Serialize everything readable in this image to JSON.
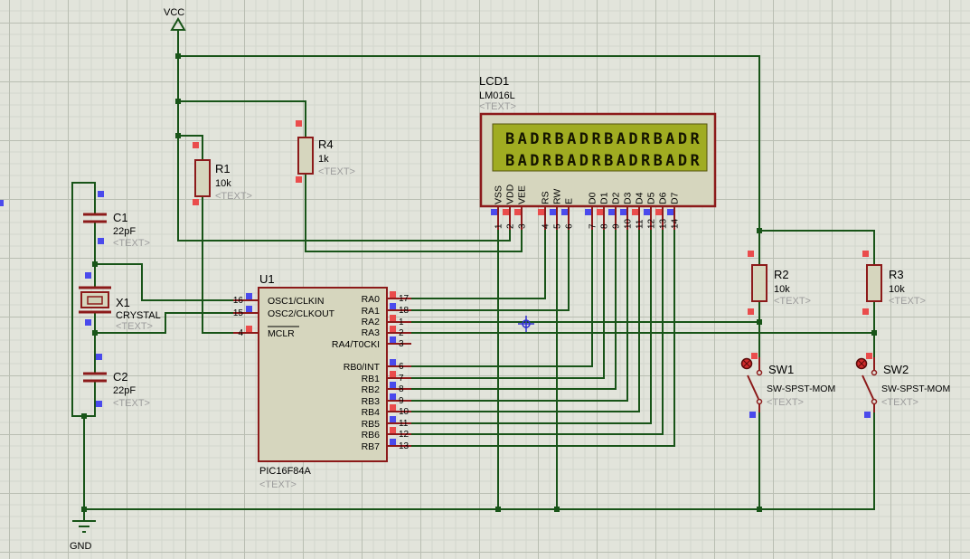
{
  "power": {
    "vcc": "VCC",
    "gnd": "GND"
  },
  "components": {
    "u1": {
      "ref": "U1",
      "value": "PIC16F84A",
      "placeholder": "<TEXT>",
      "left_pins": [
        {
          "num": "16",
          "name": "OSC1/CLKIN",
          "state": "blue"
        },
        {
          "num": "15",
          "name": "OSC2/CLKOUT",
          "state": "blue"
        },
        {
          "num": "4",
          "name": "MCLR",
          "state": "red"
        }
      ],
      "right_pins": [
        {
          "num": "17",
          "name": "RA0",
          "state": "red"
        },
        {
          "num": "18",
          "name": "RA1",
          "state": "blue"
        },
        {
          "num": "1",
          "name": "RA2",
          "state": "red"
        },
        {
          "num": "2",
          "name": "RA3",
          "state": "red"
        },
        {
          "num": "3",
          "name": "RA4/T0CKI",
          "state": "blue"
        },
        {
          "num": "6",
          "name": "RB0/INT",
          "state": "blue"
        },
        {
          "num": "7",
          "name": "RB1",
          "state": "red"
        },
        {
          "num": "8",
          "name": "RB2",
          "state": "blue"
        },
        {
          "num": "9",
          "name": "RB3",
          "state": "blue"
        },
        {
          "num": "10",
          "name": "RB4",
          "state": "red"
        },
        {
          "num": "11",
          "name": "RB5",
          "state": "blue"
        },
        {
          "num": "12",
          "name": "RB6",
          "state": "red"
        },
        {
          "num": "13",
          "name": "RB7",
          "state": "blue"
        }
      ]
    },
    "lcd1": {
      "ref": "LCD1",
      "value": "LM016L",
      "placeholder": "<TEXT>",
      "screen_line1": "BADRBADRBADRBADR",
      "screen_line2": "BADRBADRBADRBADR",
      "pins": [
        {
          "num": "1",
          "name": "VSS",
          "state": "blue"
        },
        {
          "num": "2",
          "name": "VDD",
          "state": "red"
        },
        {
          "num": "3",
          "name": "VEE",
          "state": "red"
        },
        {
          "num": "4",
          "name": "RS",
          "state": "red"
        },
        {
          "num": "5",
          "name": "RW",
          "state": "blue"
        },
        {
          "num": "6",
          "name": "E",
          "state": "blue"
        },
        {
          "num": "7",
          "name": "D0",
          "state": "blue"
        },
        {
          "num": "8",
          "name": "D1",
          "state": "red"
        },
        {
          "num": "9",
          "name": "D2",
          "state": "blue"
        },
        {
          "num": "10",
          "name": "D3",
          "state": "blue"
        },
        {
          "num": "11",
          "name": "D4",
          "state": "red"
        },
        {
          "num": "12",
          "name": "D5",
          "state": "blue"
        },
        {
          "num": "13",
          "name": "D6",
          "state": "red"
        },
        {
          "num": "14",
          "name": "D7",
          "state": "blue"
        }
      ]
    },
    "r1": {
      "ref": "R1",
      "value": "10k",
      "placeholder": "<TEXT>"
    },
    "r2": {
      "ref": "R2",
      "value": "10k",
      "placeholder": "<TEXT>"
    },
    "r3": {
      "ref": "R3",
      "value": "10k",
      "placeholder": "<TEXT>"
    },
    "r4": {
      "ref": "R4",
      "value": "1k",
      "placeholder": "<TEXT>"
    },
    "c1": {
      "ref": "C1",
      "value": "22pF",
      "placeholder": "<TEXT>"
    },
    "c2": {
      "ref": "C2",
      "value": "22pF",
      "placeholder": "<TEXT>"
    },
    "x1": {
      "ref": "X1",
      "value": "CRYSTAL",
      "placeholder": "<TEXT>"
    },
    "sw1": {
      "ref": "SW1",
      "value": "SW-SPST-MOM",
      "placeholder": "<TEXT>"
    },
    "sw2": {
      "ref": "SW2",
      "value": "SW-SPST-MOM",
      "placeholder": "<TEXT>"
    }
  },
  "colors": {
    "background": "#e2e4db",
    "grid_minor": "#d2d6cc",
    "grid_major": "#b9beb2",
    "wire": "#185418",
    "component_outline": "#8c1a1a",
    "component_fill": "#d6d6be",
    "pin_state_high": "#ea4c4c",
    "pin_state_low": "#4a4aec",
    "lcd_screen": "#a0ac21",
    "origin_marker": "#2f2fd0",
    "placeholder_text": "#9c9c9c"
  }
}
